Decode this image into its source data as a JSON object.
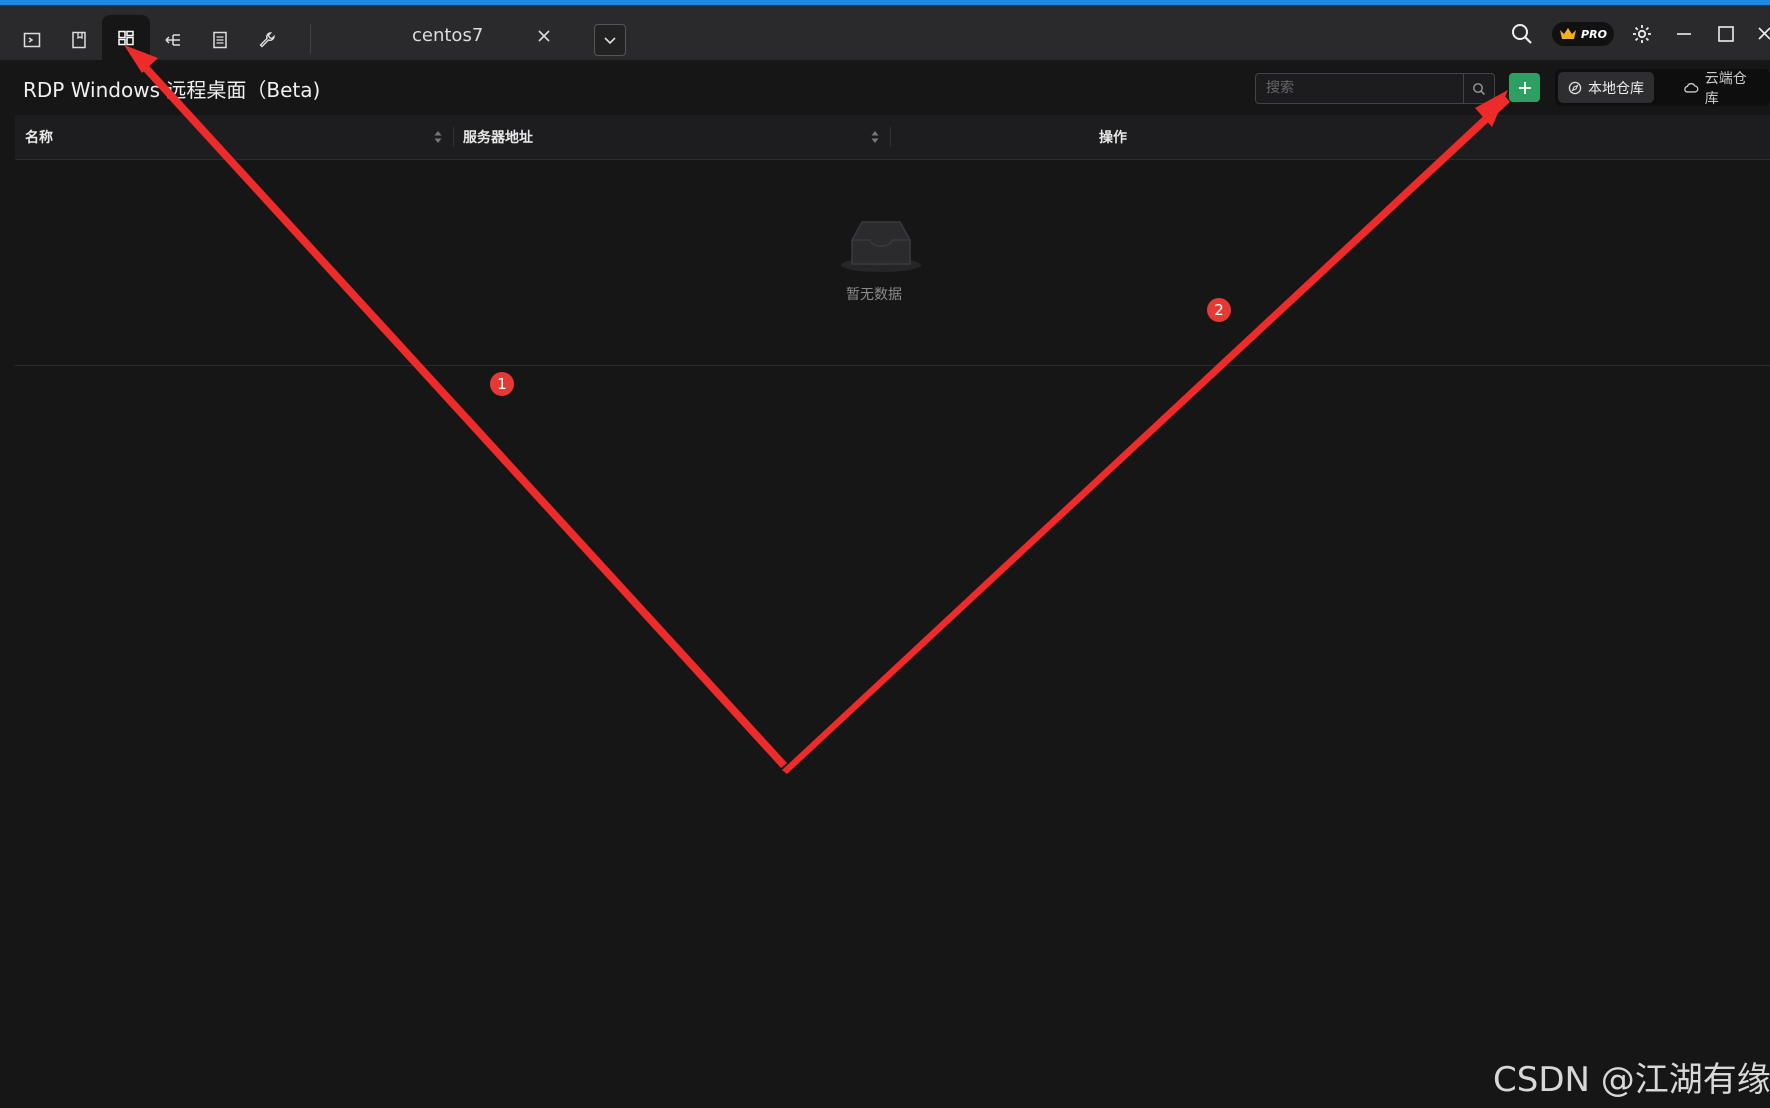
{
  "toolbar": {
    "icons": [
      "terminal-icon",
      "file-icon",
      "rdp-grid-icon",
      "tunnel-icon",
      "list-icon",
      "wrench-icon"
    ],
    "active": "rdp-grid-icon"
  },
  "tab": {
    "label": "centos7"
  },
  "window": {
    "pro_label": "PRO"
  },
  "page": {
    "title": "RDP Windows 远程桌面（Beta)"
  },
  "search": {
    "placeholder": "搜索",
    "value": ""
  },
  "segment": {
    "local_label": "本地仓库",
    "cloud_label": "云端仓库",
    "active": "local"
  },
  "table": {
    "columns": [
      "名称",
      "服务器地址",
      "操作"
    ],
    "empty_text": "暂无数据"
  },
  "annotations": {
    "badge1": "1",
    "badge2": "2"
  },
  "watermark": "CSDN @江湖有缘",
  "colors": {
    "accent_green": "#2f9e63",
    "annotation_red": "#e53935",
    "top_line": "#1e88e5",
    "background": "#161617"
  }
}
